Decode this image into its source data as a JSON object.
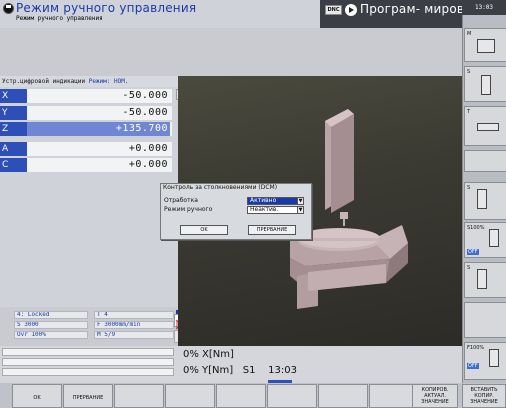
{
  "header": {
    "title": "Режим ручного управления",
    "subtitle": "Режим ручного управления",
    "dnc_label": "DNC",
    "program_mode": "Програм- мирование",
    "clock": "13:03"
  },
  "position_display": {
    "title": "Устр.цифровой индикации",
    "mode_label": "Режим: НОМ.",
    "axes": [
      {
        "axis": "X",
        "value": "-50.000",
        "selected": false
      },
      {
        "axis": "Y",
        "value": "-50.000",
        "selected": false
      },
      {
        "axis": "Z",
        "value": "+135.700",
        "selected": true
      },
      {
        "axis": "A",
        "value": "+0.000",
        "selected": false
      },
      {
        "axis": "C",
        "value": "+0.000",
        "selected": false
      }
    ]
  },
  "status": {
    "tool_state": "4: Locked",
    "tool": "T 4",
    "spindle": "S 3000",
    "feed": "F 3000mm/min",
    "override": "Ovr 100%",
    "m_func": "M 5/9"
  },
  "dialog": {
    "title": "Контроль за столкновениями (DCM)",
    "row1_label": "Отработка",
    "row1_value": "Активно",
    "row2_label": "Режим ручного",
    "row2_value": "Неактив.",
    "ok": "OK",
    "cancel": "ПРЕРВАНИЕ"
  },
  "info": {
    "line1": "0% X[Nm]",
    "line2_a": "0% Y[Nm]",
    "line2_b": "S1",
    "line2_c": "13:03"
  },
  "right_softkeys": {
    "m_label": "M",
    "s_label": "S",
    "t_label": "T",
    "s100": "S100%",
    "off": "OFF",
    "f100": "F100%",
    "off2": "OFF"
  },
  "bottom_softkeys": {
    "ok": "OK",
    "cancel": "ПРЕРВАНИЕ",
    "copy_value_1": "КОПИРОВ. АКТУАЛ. ЗНАЧЕНИЕ",
    "copy_value_2": "ВСТАВИТЬ КОПИР. ЗНАЧЕНИЕ"
  }
}
